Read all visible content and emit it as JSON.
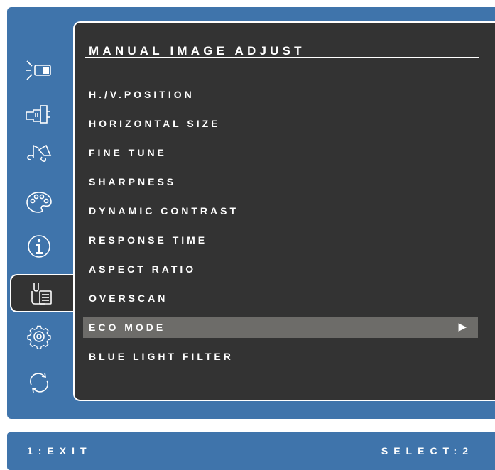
{
  "menu": {
    "title": "MANUAL IMAGE ADJUST",
    "items": [
      {
        "label": "H./V.POSITION"
      },
      {
        "label": "HORIZONTAL SIZE"
      },
      {
        "label": "FINE TUNE"
      },
      {
        "label": "SHARPNESS"
      },
      {
        "label": "DYNAMIC CONTRAST"
      },
      {
        "label": "RESPONSE TIME"
      },
      {
        "label": "ASPECT RATIO"
      },
      {
        "label": "OVERSCAN"
      },
      {
        "label": "ECO MODE",
        "selected": true,
        "arrow": "▶"
      },
      {
        "label": "BLUE LIGHT FILTER"
      }
    ]
  },
  "sidebar": {
    "icons": [
      "brightness-icon",
      "input-select-icon",
      "audio-icon",
      "color-icon",
      "information-icon",
      "manual-image-adjust-icon",
      "setup-icon",
      "memory-recall-icon"
    ],
    "active": "manual-image-adjust-icon"
  },
  "status": {
    "exit": "1:EXIT",
    "select": "SELECT:2"
  },
  "colors": {
    "frame": "#3f74ab",
    "panel": "#333333",
    "selected_row": "#6d6c69",
    "text": "#ffffff"
  }
}
